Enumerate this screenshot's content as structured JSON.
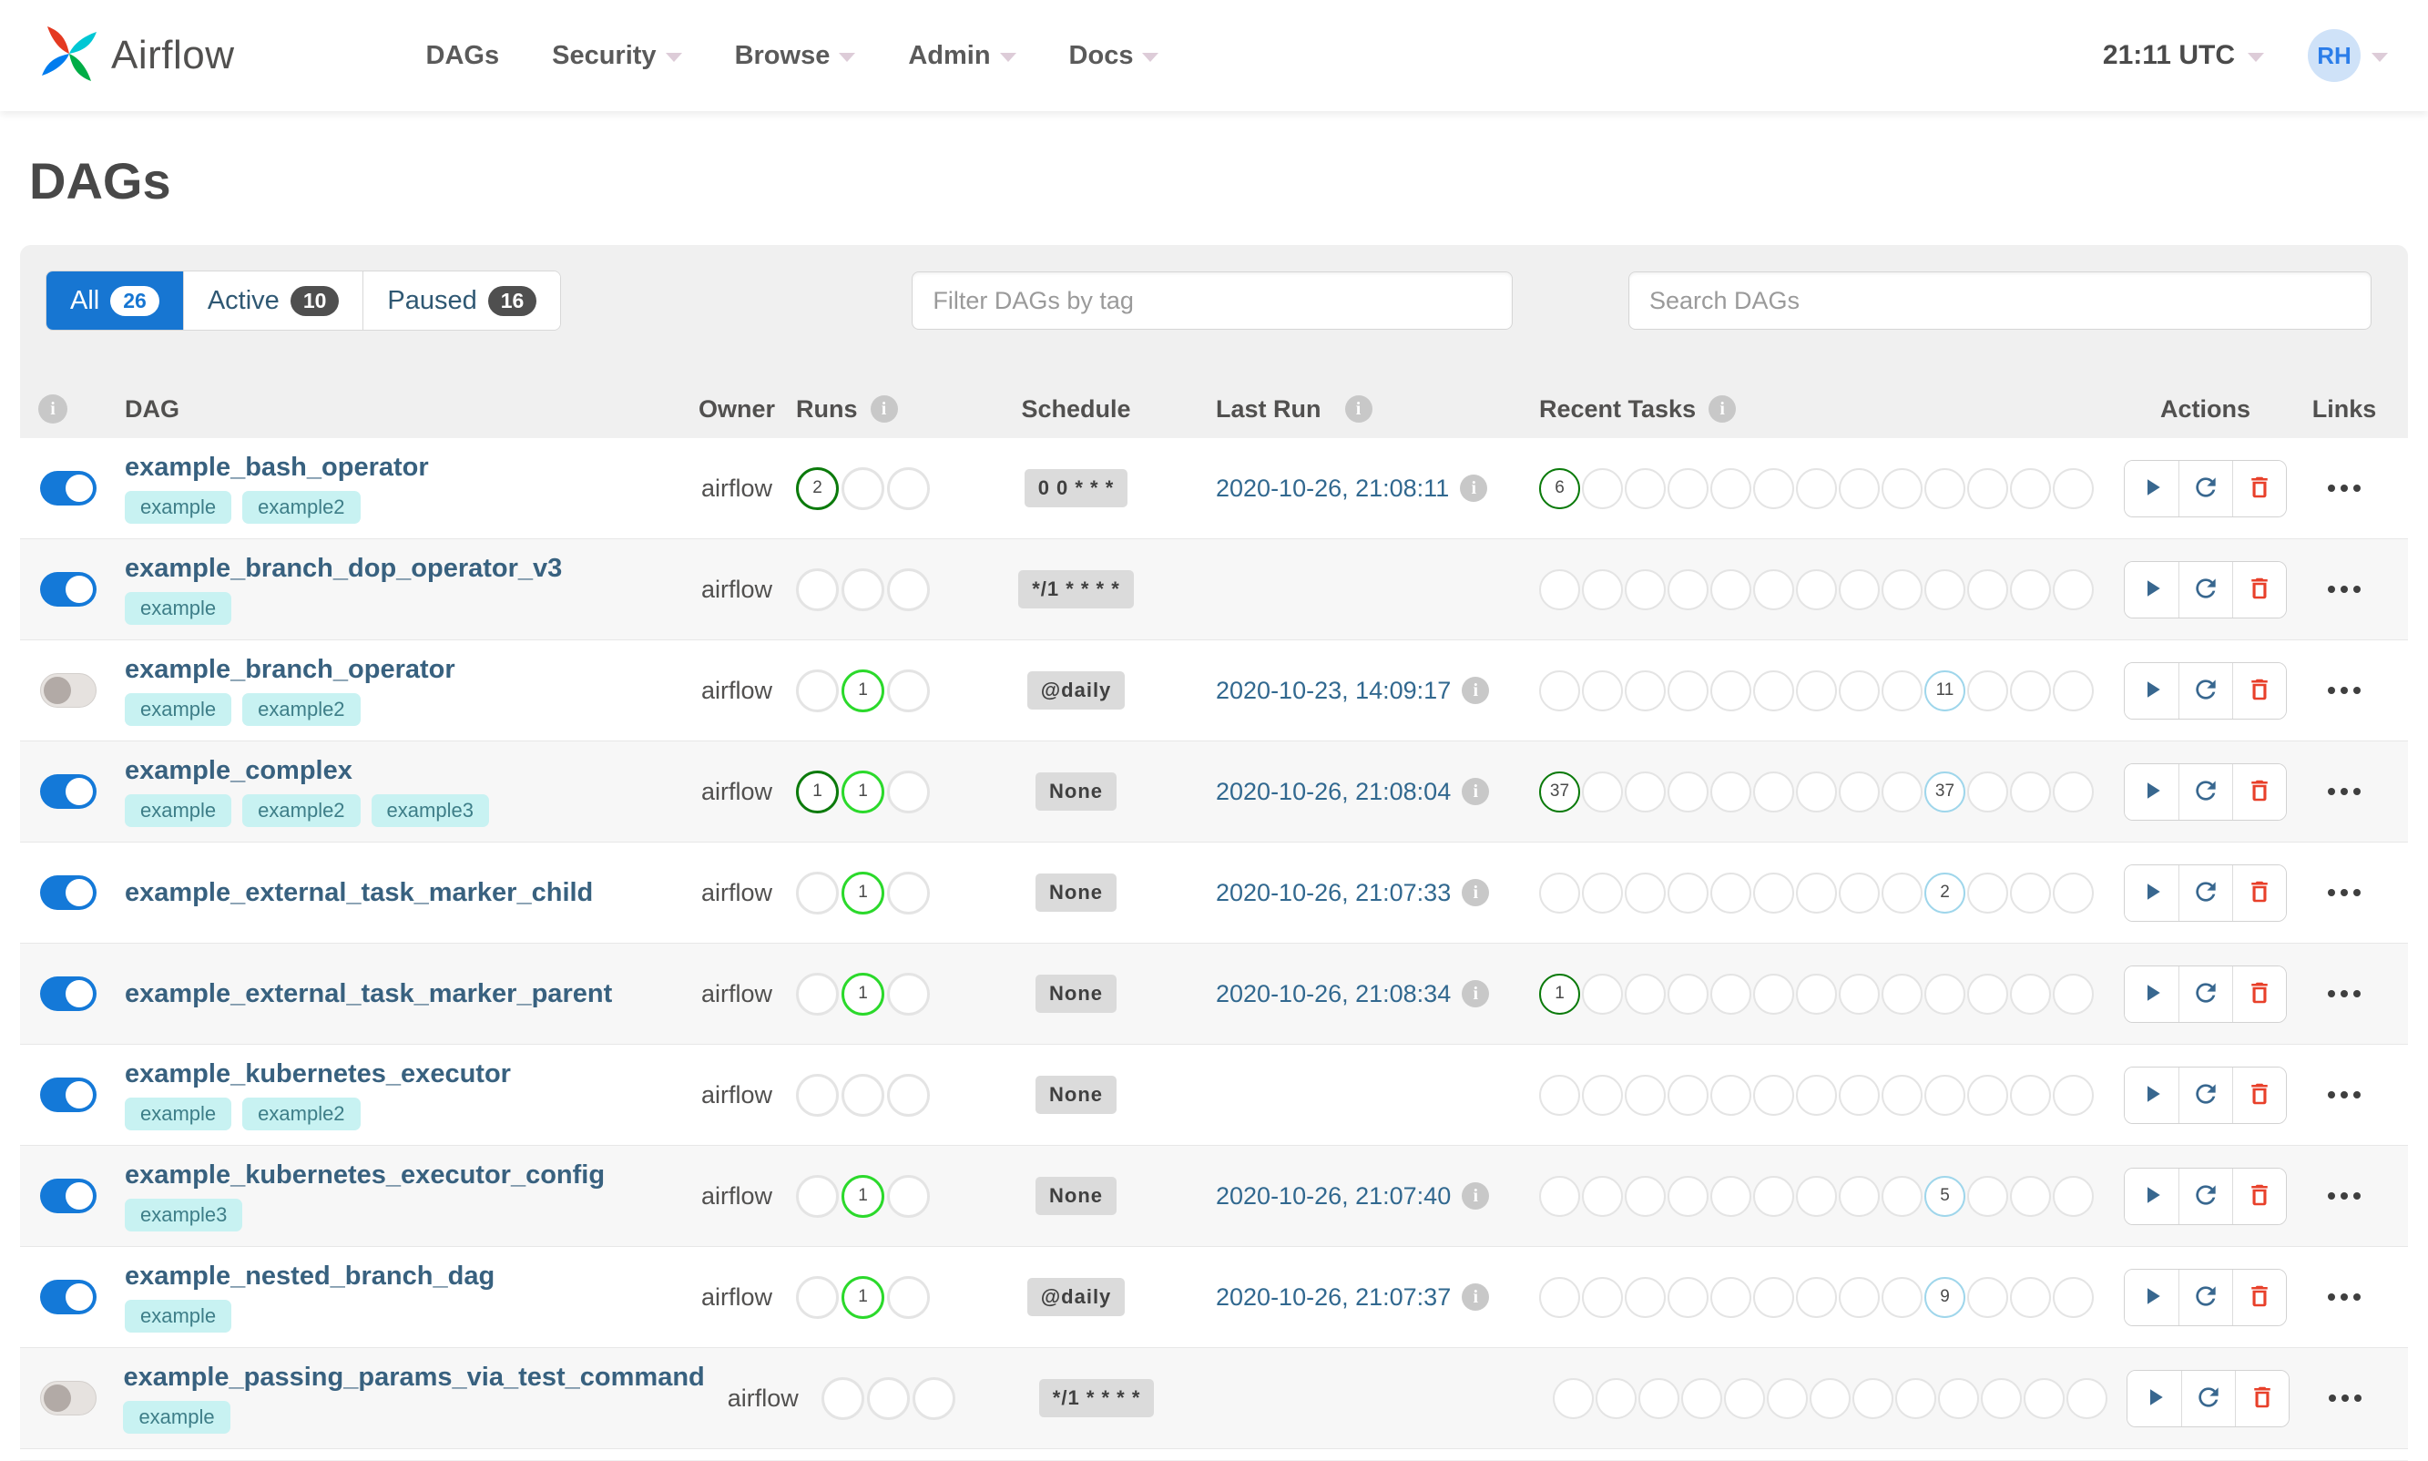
{
  "navbar": {
    "brand": "Airflow",
    "menu": [
      {
        "label": "DAGs",
        "caret": false
      },
      {
        "label": "Security",
        "caret": true
      },
      {
        "label": "Browse",
        "caret": true
      },
      {
        "label": "Admin",
        "caret": true
      },
      {
        "label": "Docs",
        "caret": true
      }
    ],
    "clock": "21:11 UTC",
    "avatar_initials": "RH"
  },
  "page": {
    "title": "DAGs"
  },
  "filters": {
    "tabs": [
      {
        "label": "All",
        "count": "26",
        "active": true
      },
      {
        "label": "Active",
        "count": "10",
        "active": false
      },
      {
        "label": "Paused",
        "count": "16",
        "active": false
      }
    ],
    "tag_filter_placeholder": "Filter DAGs by tag",
    "search_placeholder": "Search DAGs"
  },
  "icons": {
    "brand": "airflow-pinwheel-icon",
    "header_info": "info-icon",
    "trigger": "play-icon",
    "refresh": "refresh-icon",
    "delete": "trash-icon",
    "links": "ellipsis-icon",
    "dropdown": "chevron-down-icon"
  },
  "colors": {
    "accent_blue": "#1776d2",
    "toggle_on": "#1479d8",
    "dag_link": "#38617f",
    "lastrun_link": "#31688f",
    "tag_bg": "#c8f2f2",
    "tag_text": "#3e7e88",
    "state_success": "#0b7a0b",
    "state_running": "#2bd92b",
    "state_failed": "#e43921",
    "state_none": "#9fd6eb",
    "action_blue": "#38678f",
    "delete_red": "#e8402a",
    "card_bg": "#f0f0f0"
  },
  "table": {
    "headers": {
      "dag": "DAG",
      "owner": "Owner",
      "runs": "Runs",
      "schedule": "Schedule",
      "last_run": "Last Run",
      "recent_tasks": "Recent Tasks",
      "actions": "Actions",
      "links": "Links"
    },
    "runs_slots": 3,
    "recent_slots": 13,
    "rows": [
      {
        "name": "example_bash_operator",
        "tags": [
          "example",
          "example2"
        ],
        "enabled": true,
        "owner": "airflow",
        "runs": [
          {
            "slot": 1,
            "value": "2",
            "state": "success"
          }
        ],
        "schedule": "0 0 * * *",
        "last_run": "2020-10-26, 21:08:11",
        "recent": [
          {
            "slot": 1,
            "value": "6",
            "state": "success"
          }
        ]
      },
      {
        "name": "example_branch_dop_operator_v3",
        "tags": [
          "example"
        ],
        "enabled": true,
        "owner": "airflow",
        "runs": [],
        "schedule": "*/1 * * * *",
        "last_run": "",
        "recent": []
      },
      {
        "name": "example_branch_operator",
        "tags": [
          "example",
          "example2"
        ],
        "enabled": false,
        "owner": "airflow",
        "runs": [
          {
            "slot": 2,
            "value": "1",
            "state": "running"
          }
        ],
        "schedule": "@daily",
        "last_run": "2020-10-23, 14:09:17",
        "recent": [
          {
            "slot": 10,
            "value": "11",
            "state": "none"
          }
        ]
      },
      {
        "name": "example_complex",
        "tags": [
          "example",
          "example2",
          "example3"
        ],
        "enabled": true,
        "owner": "airflow",
        "runs": [
          {
            "slot": 1,
            "value": "1",
            "state": "success"
          },
          {
            "slot": 2,
            "value": "1",
            "state": "running"
          }
        ],
        "schedule": "None",
        "last_run": "2020-10-26, 21:08:04",
        "recent": [
          {
            "slot": 1,
            "value": "37",
            "state": "success"
          },
          {
            "slot": 10,
            "value": "37",
            "state": "none"
          }
        ]
      },
      {
        "name": "example_external_task_marker_child",
        "tags": [],
        "enabled": true,
        "owner": "airflow",
        "runs": [
          {
            "slot": 2,
            "value": "1",
            "state": "running"
          }
        ],
        "schedule": "None",
        "last_run": "2020-10-26, 21:07:33",
        "recent": [
          {
            "slot": 10,
            "value": "2",
            "state": "none"
          }
        ]
      },
      {
        "name": "example_external_task_marker_parent",
        "tags": [],
        "enabled": true,
        "owner": "airflow",
        "runs": [
          {
            "slot": 2,
            "value": "1",
            "state": "running"
          }
        ],
        "schedule": "None",
        "last_run": "2020-10-26, 21:08:34",
        "recent": [
          {
            "slot": 1,
            "value": "1",
            "state": "success"
          }
        ]
      },
      {
        "name": "example_kubernetes_executor",
        "tags": [
          "example",
          "example2"
        ],
        "enabled": true,
        "owner": "airflow",
        "runs": [],
        "schedule": "None",
        "last_run": "",
        "recent": []
      },
      {
        "name": "example_kubernetes_executor_config",
        "tags": [
          "example3"
        ],
        "enabled": true,
        "owner": "airflow",
        "runs": [
          {
            "slot": 2,
            "value": "1",
            "state": "running"
          }
        ],
        "schedule": "None",
        "last_run": "2020-10-26, 21:07:40",
        "recent": [
          {
            "slot": 10,
            "value": "5",
            "state": "none"
          }
        ]
      },
      {
        "name": "example_nested_branch_dag",
        "tags": [
          "example"
        ],
        "enabled": true,
        "owner": "airflow",
        "runs": [
          {
            "slot": 2,
            "value": "1",
            "state": "running"
          }
        ],
        "schedule": "@daily",
        "last_run": "2020-10-26, 21:07:37",
        "recent": [
          {
            "slot": 10,
            "value": "9",
            "state": "none"
          }
        ]
      },
      {
        "name": "example_passing_params_via_test_command",
        "tags": [
          "example"
        ],
        "enabled": false,
        "owner": "airflow",
        "runs": [],
        "schedule": "*/1 * * * *",
        "last_run": "",
        "recent": []
      }
    ]
  }
}
